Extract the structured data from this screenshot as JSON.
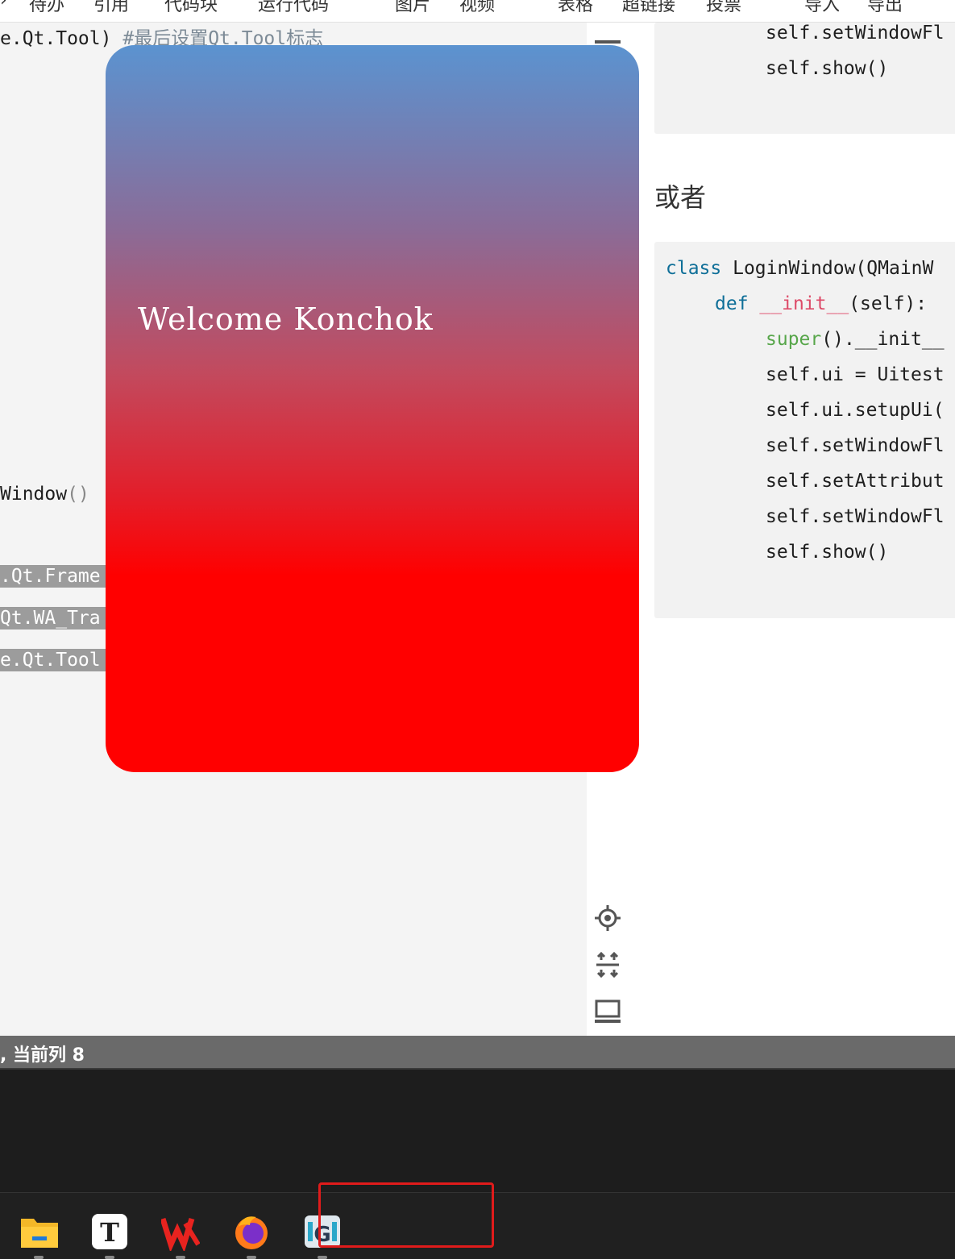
{
  "toolbar": {
    "items": [
      "待办",
      "引用",
      "代码块",
      "运行代码",
      "图片",
      "视频",
      "表格",
      "超链接",
      "投票",
      "导入",
      "导出"
    ]
  },
  "editor": {
    "line1_code": "e.Qt.Tool)",
    "line1_comment": "#最后设置Qt.Tool标志",
    "line2_code": "Window",
    "line2_paren": "()",
    "hl1": ".Qt.Frame",
    "hl2": "Qt.WA_Tra",
    "hl3": "e.Qt.Tool"
  },
  "floating_window": {
    "welcome_text": "Welcome Konchok"
  },
  "preview": {
    "top_block": {
      "line1": "self.setWindowFl",
      "line2": "self.show()"
    },
    "heading": "或者",
    "code": {
      "class_kw": "class",
      "class_name": "LoginWindow(QMainW",
      "def_kw": "def",
      "init_name": "__init__",
      "init_rest": "(self):",
      "super_kw": "super",
      "super_rest": "().__init__",
      "l4": "self.ui = Uitest",
      "l5": "self.ui.setupUi(",
      "l6": "self.setWindowFl",
      "l7": "self.setAttribut",
      "l8": "self.setWindowFl",
      "l9": "self.show()"
    }
  },
  "statusbar": {
    "text": ", 当前列 8"
  },
  "taskbar": {
    "apps": [
      "file-explorer-icon",
      "typora-icon",
      "wps-icon",
      "firefox-icon",
      "app-icon"
    ]
  }
}
